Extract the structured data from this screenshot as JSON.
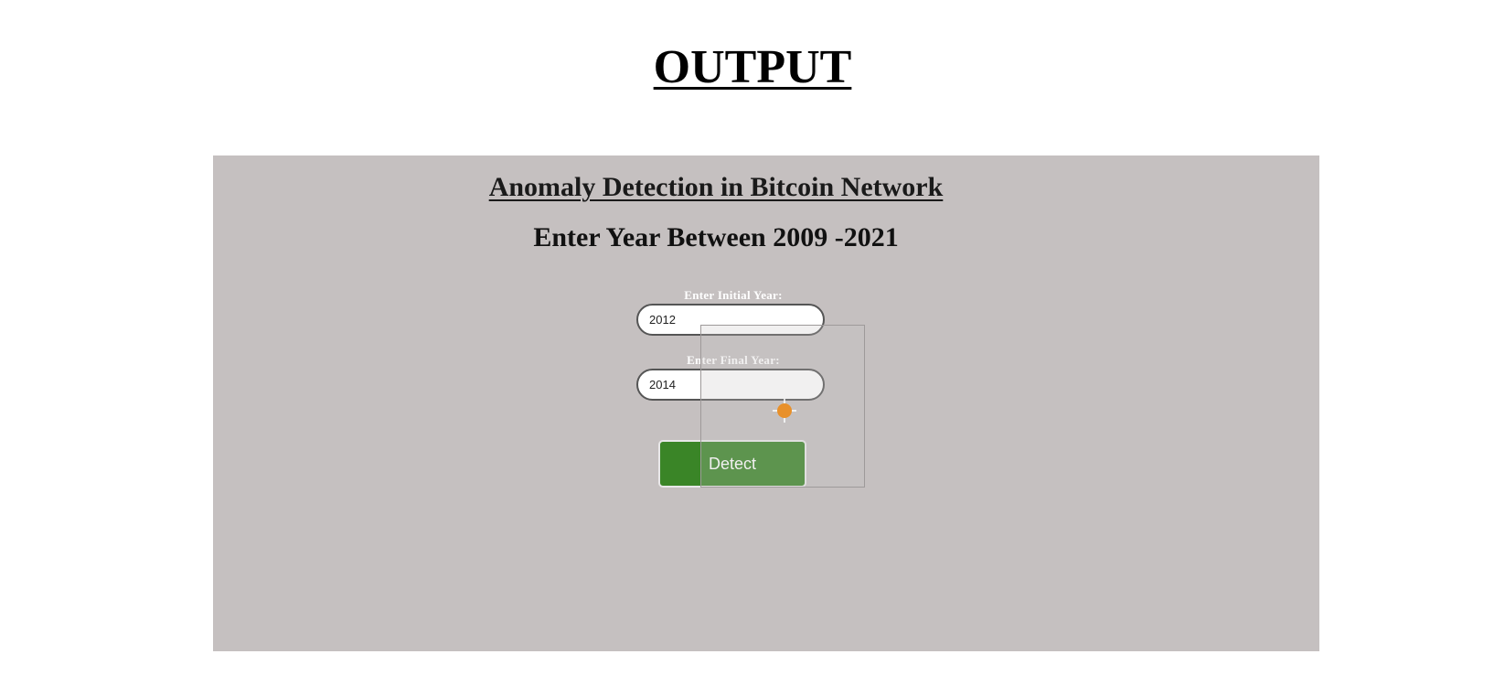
{
  "document": {
    "heading": "OUTPUT"
  },
  "app": {
    "title": "Anomaly Detection in Bitcoin Network",
    "subtitle": "Enter Year Between 2009 -2021",
    "background_color": "#c5c0c0",
    "form": {
      "initial_year_label": "Enter Initial Year:",
      "initial_year_value": "2012",
      "final_year_label": "Enter Final Year:",
      "final_year_value": "2014",
      "detect_label": "Detect",
      "detect_color": "#3a8527"
    },
    "cursor": {
      "icon": "crosshair-cursor-icon",
      "color": "#e8902a"
    }
  }
}
